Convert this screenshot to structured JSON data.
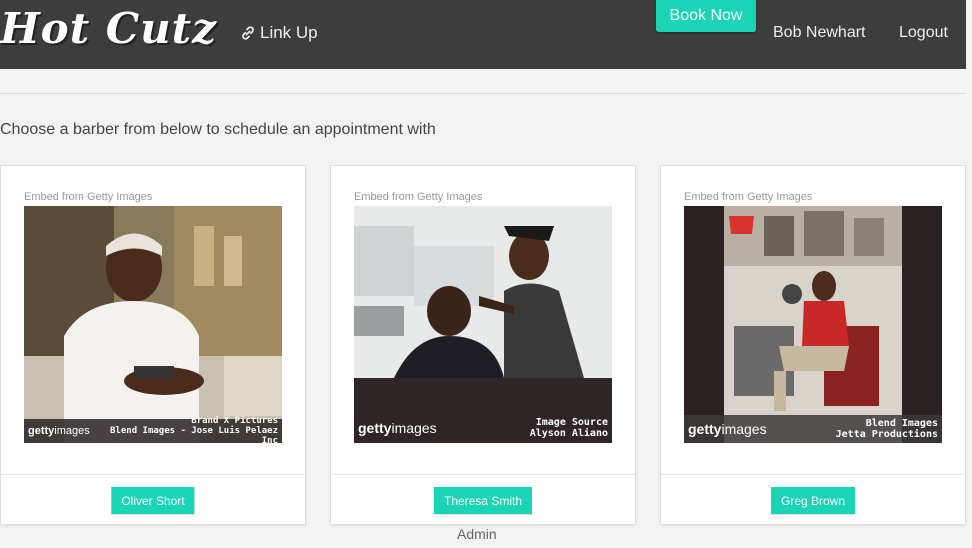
{
  "nav": {
    "brand": "Hot Cutz",
    "link_up": "Link Up",
    "book_now": "Book Now",
    "user": "Bob Newhart",
    "logout": "Logout"
  },
  "main": {
    "instructions": "Choose a barber from below to schedule an appointment with",
    "barbers": [
      {
        "embed_label": "Embed from Getty Images",
        "name": "Oliver Short",
        "getty_brand": "getty",
        "getty_suffix": "images",
        "credit_line1": "Brand X Pictures",
        "credit_line2": "Blend Images - Jose Luis Pelaez Inc"
      },
      {
        "embed_label": "Embed from Getty Images",
        "name": "Theresa Smith",
        "getty_brand": "getty",
        "getty_suffix": "images",
        "credit_line1": "Image Source",
        "credit_line2": "Alyson Aliano"
      },
      {
        "embed_label": "Embed from Getty Images",
        "name": "Greg Brown",
        "getty_brand": "getty",
        "getty_suffix": "images",
        "credit_line1": "Blend Images",
        "credit_line2": "Jetta Productions"
      }
    ]
  },
  "footer": {
    "admin": "Admin"
  },
  "colors": {
    "navbar": "#3d3d3d",
    "accent": "#1ad4b5",
    "background": "#f3f3f3"
  }
}
